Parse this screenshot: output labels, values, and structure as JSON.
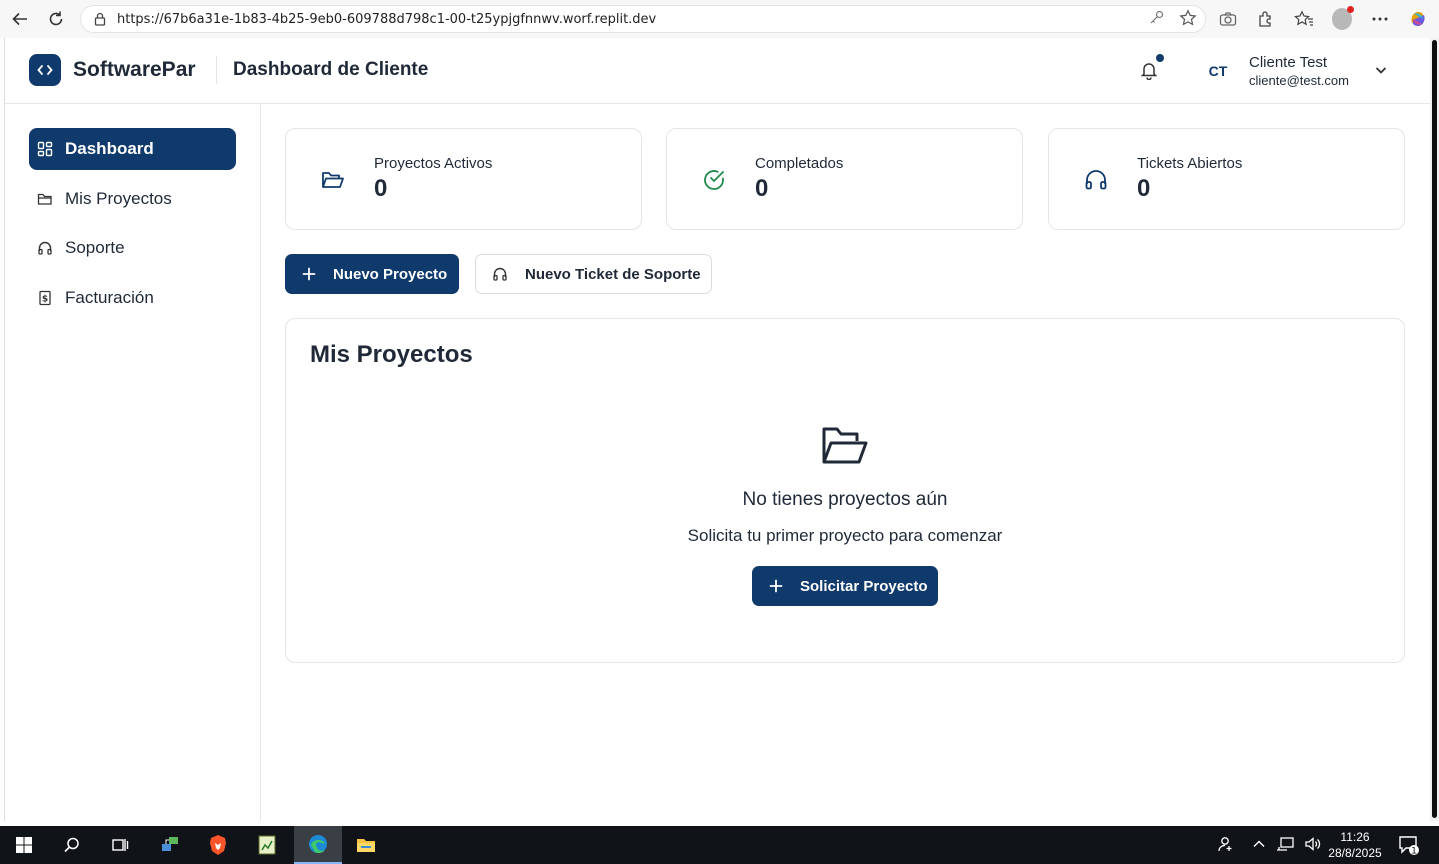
{
  "browser": {
    "url": "https://67b6a31e-1b83-4b25-9eb0-609788d798c1-00-t25ypjgfnnwv.worf.replit.dev"
  },
  "header": {
    "brand": "SoftwarePar",
    "title": "Dashboard de Cliente",
    "avatar_initials": "CT",
    "user_name": "Cliente Test",
    "user_email": "cliente@test.com"
  },
  "sidebar": {
    "items": [
      {
        "label": "Dashboard",
        "icon": "grid-icon"
      },
      {
        "label": "Mis Proyectos",
        "icon": "folder-icon"
      },
      {
        "label": "Soporte",
        "icon": "headphones-icon"
      },
      {
        "label": "Facturación",
        "icon": "receipt-icon"
      }
    ]
  },
  "stats": [
    {
      "label": "Proyectos Activos",
      "value": "0",
      "icon": "folder-open-icon",
      "color": "#0f3a6b"
    },
    {
      "label": "Completados",
      "value": "0",
      "icon": "check-circle-icon",
      "color": "#1f8a4c"
    },
    {
      "label": "Tickets Abiertos",
      "value": "0",
      "icon": "headphones-icon",
      "color": "#0f3a6b"
    }
  ],
  "actions": {
    "new_project": "Nuevo Proyecto",
    "new_ticket": "Nuevo Ticket de Soporte"
  },
  "projects": {
    "title": "Mis Proyectos",
    "empty_title": "No tienes proyectos aún",
    "empty_subtitle": "Solicita tu primer proyecto para comenzar",
    "request_button": "Solicitar Proyecto"
  },
  "taskbar": {
    "time": "11:26",
    "date": "28/8/2025",
    "notifications": "1"
  },
  "colors": {
    "primary": "#0f3a6b",
    "success": "#1f8a4c"
  }
}
